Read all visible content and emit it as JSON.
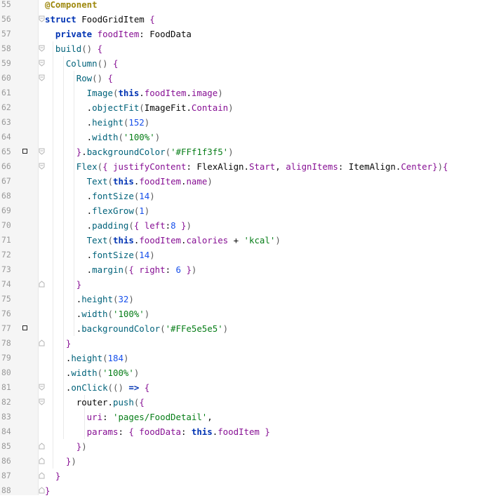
{
  "colors": {
    "keyword": "#0033b3",
    "annotation": "#9e880d",
    "function": "#00627a",
    "property": "#871094",
    "string": "#067d17",
    "number": "#1750eb",
    "plain": "#080808",
    "brace": "#871094",
    "paren": "#5a5a5a"
  },
  "lines": [
    {
      "num": "55",
      "tokens": [
        {
          "t": "@Component",
          "c": "annotation"
        }
      ]
    },
    {
      "num": "56",
      "tokens": [
        {
          "t": "struct ",
          "c": "keyword"
        },
        {
          "t": "FoodGridItem ",
          "c": "plain"
        },
        {
          "t": "{",
          "c": "brace"
        }
      ]
    },
    {
      "num": "57",
      "tokens": [
        {
          "t": "  private ",
          "c": "keyword"
        },
        {
          "t": "foodItem",
          "c": "property"
        },
        {
          "t": ": ",
          "c": "plain"
        },
        {
          "t": "FoodData",
          "c": "plain"
        }
      ]
    },
    {
      "num": "58",
      "tokens": [
        {
          "t": "  build",
          "c": "function"
        },
        {
          "t": "() ",
          "c": "paren"
        },
        {
          "t": "{",
          "c": "brace"
        }
      ]
    },
    {
      "num": "59",
      "tokens": [
        {
          "t": "    Column",
          "c": "function"
        },
        {
          "t": "() ",
          "c": "paren"
        },
        {
          "t": "{",
          "c": "brace"
        }
      ]
    },
    {
      "num": "60",
      "tokens": [
        {
          "t": "      Row",
          "c": "function"
        },
        {
          "t": "() ",
          "c": "paren"
        },
        {
          "t": "{",
          "c": "brace"
        }
      ]
    },
    {
      "num": "61",
      "tokens": [
        {
          "t": "        Image",
          "c": "function"
        },
        {
          "t": "(",
          "c": "paren"
        },
        {
          "t": "this",
          "c": "keyword"
        },
        {
          "t": ".",
          "c": "plain"
        },
        {
          "t": "foodItem",
          "c": "property"
        },
        {
          "t": ".",
          "c": "plain"
        },
        {
          "t": "image",
          "c": "property"
        },
        {
          "t": ")",
          "c": "paren"
        }
      ]
    },
    {
      "num": "62",
      "tokens": [
        {
          "t": "        .",
          "c": "plain"
        },
        {
          "t": "objectFit",
          "c": "function"
        },
        {
          "t": "(",
          "c": "paren"
        },
        {
          "t": "ImageFit",
          "c": "plain"
        },
        {
          "t": ".",
          "c": "plain"
        },
        {
          "t": "Contain",
          "c": "property"
        },
        {
          "t": ")",
          "c": "paren"
        }
      ]
    },
    {
      "num": "63",
      "tokens": [
        {
          "t": "        .",
          "c": "plain"
        },
        {
          "t": "height",
          "c": "function"
        },
        {
          "t": "(",
          "c": "paren"
        },
        {
          "t": "152",
          "c": "number"
        },
        {
          "t": ")",
          "c": "paren"
        }
      ]
    },
    {
      "num": "64",
      "tokens": [
        {
          "t": "        .",
          "c": "plain"
        },
        {
          "t": "width",
          "c": "function"
        },
        {
          "t": "(",
          "c": "paren"
        },
        {
          "t": "'100%'",
          "c": "string"
        },
        {
          "t": ")",
          "c": "paren"
        }
      ]
    },
    {
      "num": "65",
      "bp": true,
      "tokens": [
        {
          "t": "      }",
          "c": "brace"
        },
        {
          "t": ".",
          "c": "plain"
        },
        {
          "t": "backgroundColor",
          "c": "function"
        },
        {
          "t": "(",
          "c": "paren"
        },
        {
          "t": "'#FFf1f3f5'",
          "c": "string"
        },
        {
          "t": ")",
          "c": "paren"
        }
      ]
    },
    {
      "num": "66",
      "tokens": [
        {
          "t": "      Flex",
          "c": "function"
        },
        {
          "t": "(",
          "c": "paren"
        },
        {
          "t": "{ ",
          "c": "brace"
        },
        {
          "t": "justifyContent",
          "c": "property"
        },
        {
          "t": ": ",
          "c": "plain"
        },
        {
          "t": "FlexAlign",
          "c": "plain"
        },
        {
          "t": ".",
          "c": "plain"
        },
        {
          "t": "Start",
          "c": "property"
        },
        {
          "t": ", ",
          "c": "plain"
        },
        {
          "t": "alignItems",
          "c": "property"
        },
        {
          "t": ": ",
          "c": "plain"
        },
        {
          "t": "ItemAlign",
          "c": "plain"
        },
        {
          "t": ".",
          "c": "plain"
        },
        {
          "t": "Center",
          "c": "property"
        },
        {
          "t": "}",
          "c": "brace"
        },
        {
          "t": ")",
          "c": "paren"
        },
        {
          "t": "{",
          "c": "brace"
        }
      ]
    },
    {
      "num": "67",
      "tokens": [
        {
          "t": "        Text",
          "c": "function"
        },
        {
          "t": "(",
          "c": "paren"
        },
        {
          "t": "this",
          "c": "keyword"
        },
        {
          "t": ".",
          "c": "plain"
        },
        {
          "t": "foodItem",
          "c": "property"
        },
        {
          "t": ".",
          "c": "plain"
        },
        {
          "t": "name",
          "c": "property"
        },
        {
          "t": ")",
          "c": "paren"
        }
      ]
    },
    {
      "num": "68",
      "tokens": [
        {
          "t": "        .",
          "c": "plain"
        },
        {
          "t": "fontSize",
          "c": "function"
        },
        {
          "t": "(",
          "c": "paren"
        },
        {
          "t": "14",
          "c": "number"
        },
        {
          "t": ")",
          "c": "paren"
        }
      ]
    },
    {
      "num": "69",
      "tokens": [
        {
          "t": "        .",
          "c": "plain"
        },
        {
          "t": "flexGrow",
          "c": "function"
        },
        {
          "t": "(",
          "c": "paren"
        },
        {
          "t": "1",
          "c": "number"
        },
        {
          "t": ")",
          "c": "paren"
        }
      ]
    },
    {
      "num": "70",
      "tokens": [
        {
          "t": "        .",
          "c": "plain"
        },
        {
          "t": "padding",
          "c": "function"
        },
        {
          "t": "(",
          "c": "paren"
        },
        {
          "t": "{ ",
          "c": "brace"
        },
        {
          "t": "left",
          "c": "property"
        },
        {
          "t": ":",
          "c": "plain"
        },
        {
          "t": "8",
          "c": "number"
        },
        {
          "t": " }",
          "c": "brace"
        },
        {
          "t": ")",
          "c": "paren"
        }
      ]
    },
    {
      "num": "71",
      "tokens": [
        {
          "t": "        Text",
          "c": "function"
        },
        {
          "t": "(",
          "c": "paren"
        },
        {
          "t": "this",
          "c": "keyword"
        },
        {
          "t": ".",
          "c": "plain"
        },
        {
          "t": "foodItem",
          "c": "property"
        },
        {
          "t": ".",
          "c": "plain"
        },
        {
          "t": "calories",
          "c": "property"
        },
        {
          "t": " + ",
          "c": "plain"
        },
        {
          "t": "'kcal'",
          "c": "string"
        },
        {
          "t": ")",
          "c": "paren"
        }
      ]
    },
    {
      "num": "72",
      "tokens": [
        {
          "t": "        .",
          "c": "plain"
        },
        {
          "t": "fontSize",
          "c": "function"
        },
        {
          "t": "(",
          "c": "paren"
        },
        {
          "t": "14",
          "c": "number"
        },
        {
          "t": ")",
          "c": "paren"
        }
      ]
    },
    {
      "num": "73",
      "tokens": [
        {
          "t": "        .",
          "c": "plain"
        },
        {
          "t": "margin",
          "c": "function"
        },
        {
          "t": "(",
          "c": "paren"
        },
        {
          "t": "{ ",
          "c": "brace"
        },
        {
          "t": "right",
          "c": "property"
        },
        {
          "t": ": ",
          "c": "plain"
        },
        {
          "t": "6",
          "c": "number"
        },
        {
          "t": " }",
          "c": "brace"
        },
        {
          "t": ")",
          "c": "paren"
        }
      ]
    },
    {
      "num": "74",
      "tokens": [
        {
          "t": "      }",
          "c": "brace"
        }
      ]
    },
    {
      "num": "75",
      "tokens": [
        {
          "t": "      .",
          "c": "plain"
        },
        {
          "t": "height",
          "c": "function"
        },
        {
          "t": "(",
          "c": "paren"
        },
        {
          "t": "32",
          "c": "number"
        },
        {
          "t": ")",
          "c": "paren"
        }
      ]
    },
    {
      "num": "76",
      "tokens": [
        {
          "t": "      .",
          "c": "plain"
        },
        {
          "t": "width",
          "c": "function"
        },
        {
          "t": "(",
          "c": "paren"
        },
        {
          "t": "'100%'",
          "c": "string"
        },
        {
          "t": ")",
          "c": "paren"
        }
      ]
    },
    {
      "num": "77",
      "bp": true,
      "tokens": [
        {
          "t": "      .",
          "c": "plain"
        },
        {
          "t": "backgroundColor",
          "c": "function"
        },
        {
          "t": "(",
          "c": "paren"
        },
        {
          "t": "'#FFe5e5e5'",
          "c": "string"
        },
        {
          "t": ")",
          "c": "paren"
        }
      ]
    },
    {
      "num": "78",
      "tokens": [
        {
          "t": "    }",
          "c": "brace"
        }
      ]
    },
    {
      "num": "79",
      "tokens": [
        {
          "t": "    .",
          "c": "plain"
        },
        {
          "t": "height",
          "c": "function"
        },
        {
          "t": "(",
          "c": "paren"
        },
        {
          "t": "184",
          "c": "number"
        },
        {
          "t": ")",
          "c": "paren"
        }
      ]
    },
    {
      "num": "80",
      "tokens": [
        {
          "t": "    .",
          "c": "plain"
        },
        {
          "t": "width",
          "c": "function"
        },
        {
          "t": "(",
          "c": "paren"
        },
        {
          "t": "'100%'",
          "c": "string"
        },
        {
          "t": ")",
          "c": "paren"
        }
      ]
    },
    {
      "num": "81",
      "tokens": [
        {
          "t": "    .",
          "c": "plain"
        },
        {
          "t": "onClick",
          "c": "function"
        },
        {
          "t": "(",
          "c": "paren"
        },
        {
          "t": "() ",
          "c": "paren"
        },
        {
          "t": "=> ",
          "c": "keyword"
        },
        {
          "t": "{",
          "c": "brace"
        }
      ]
    },
    {
      "num": "82",
      "tokens": [
        {
          "t": "      router",
          "c": "plain"
        },
        {
          "t": ".",
          "c": "plain"
        },
        {
          "t": "push",
          "c": "function"
        },
        {
          "t": "(",
          "c": "paren"
        },
        {
          "t": "{",
          "c": "brace"
        }
      ]
    },
    {
      "num": "83",
      "tokens": [
        {
          "t": "        uri",
          "c": "property"
        },
        {
          "t": ": ",
          "c": "plain"
        },
        {
          "t": "'pages/FoodDetail'",
          "c": "string"
        },
        {
          "t": ",",
          "c": "plain"
        }
      ]
    },
    {
      "num": "84",
      "tokens": [
        {
          "t": "        params",
          "c": "property"
        },
        {
          "t": ": ",
          "c": "plain"
        },
        {
          "t": "{ ",
          "c": "brace"
        },
        {
          "t": "foodData",
          "c": "property"
        },
        {
          "t": ": ",
          "c": "plain"
        },
        {
          "t": "this",
          "c": "keyword"
        },
        {
          "t": ".",
          "c": "plain"
        },
        {
          "t": "foodItem",
          "c": "property"
        },
        {
          "t": " }",
          "c": "brace"
        }
      ]
    },
    {
      "num": "85",
      "tokens": [
        {
          "t": "      }",
          "c": "brace"
        },
        {
          "t": ")",
          "c": "paren"
        }
      ]
    },
    {
      "num": "86",
      "tokens": [
        {
          "t": "    }",
          "c": "brace"
        },
        {
          "t": ")",
          "c": "paren"
        }
      ]
    },
    {
      "num": "87",
      "tokens": [
        {
          "t": "  }",
          "c": "brace"
        }
      ]
    },
    {
      "num": "88",
      "tokens": [
        {
          "t": "}",
          "c": "brace"
        }
      ]
    }
  ],
  "folds": {
    "open": [
      "56",
      "58",
      "59",
      "60",
      "65",
      "66",
      "81",
      "82"
    ],
    "close": [
      "74",
      "78",
      "85",
      "86",
      "87",
      "88"
    ]
  }
}
